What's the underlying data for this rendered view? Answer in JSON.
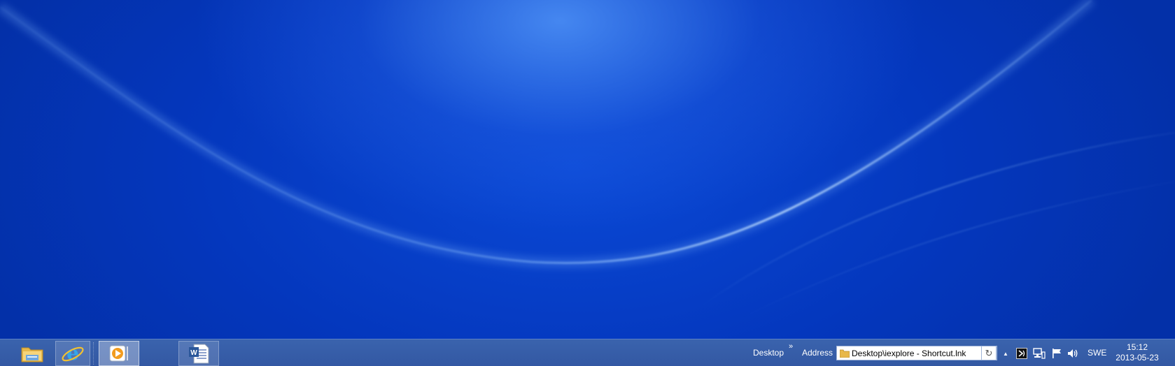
{
  "desktop": {
    "wallpaper_colors": {
      "base": "#0536b6",
      "glow": "#5aa0ff",
      "streak": "#9fd0ff"
    }
  },
  "taskbar": {
    "color": "#3a63ad",
    "pinned_apps": [
      {
        "name": "File Explorer",
        "icon": "folder-icon",
        "state": "pinned"
      },
      {
        "name": "Internet Explorer",
        "icon": "internet-explorer-icon",
        "state": "running"
      },
      {
        "name": "Windows Media Player",
        "icon": "media-player-icon",
        "state": "active"
      },
      {
        "name": "Microsoft Word",
        "icon": "word-icon",
        "state": "running"
      }
    ],
    "toolbars": {
      "desktop_label": "Desktop",
      "chevron": "»",
      "address_label": "Address",
      "address_value": "Desktop\\iexplore - Shortcut.lnk",
      "dropdown_glyph": "⌄",
      "refresh_glyph": "↻"
    },
    "tray": {
      "show_hidden_glyph": "▲",
      "icons": [
        "narrator-icon",
        "network-icon",
        "action-center-flag-icon",
        "volume-icon"
      ],
      "language": "SWE"
    },
    "clock": {
      "time": "15:12",
      "date": "2013-05-23"
    }
  }
}
